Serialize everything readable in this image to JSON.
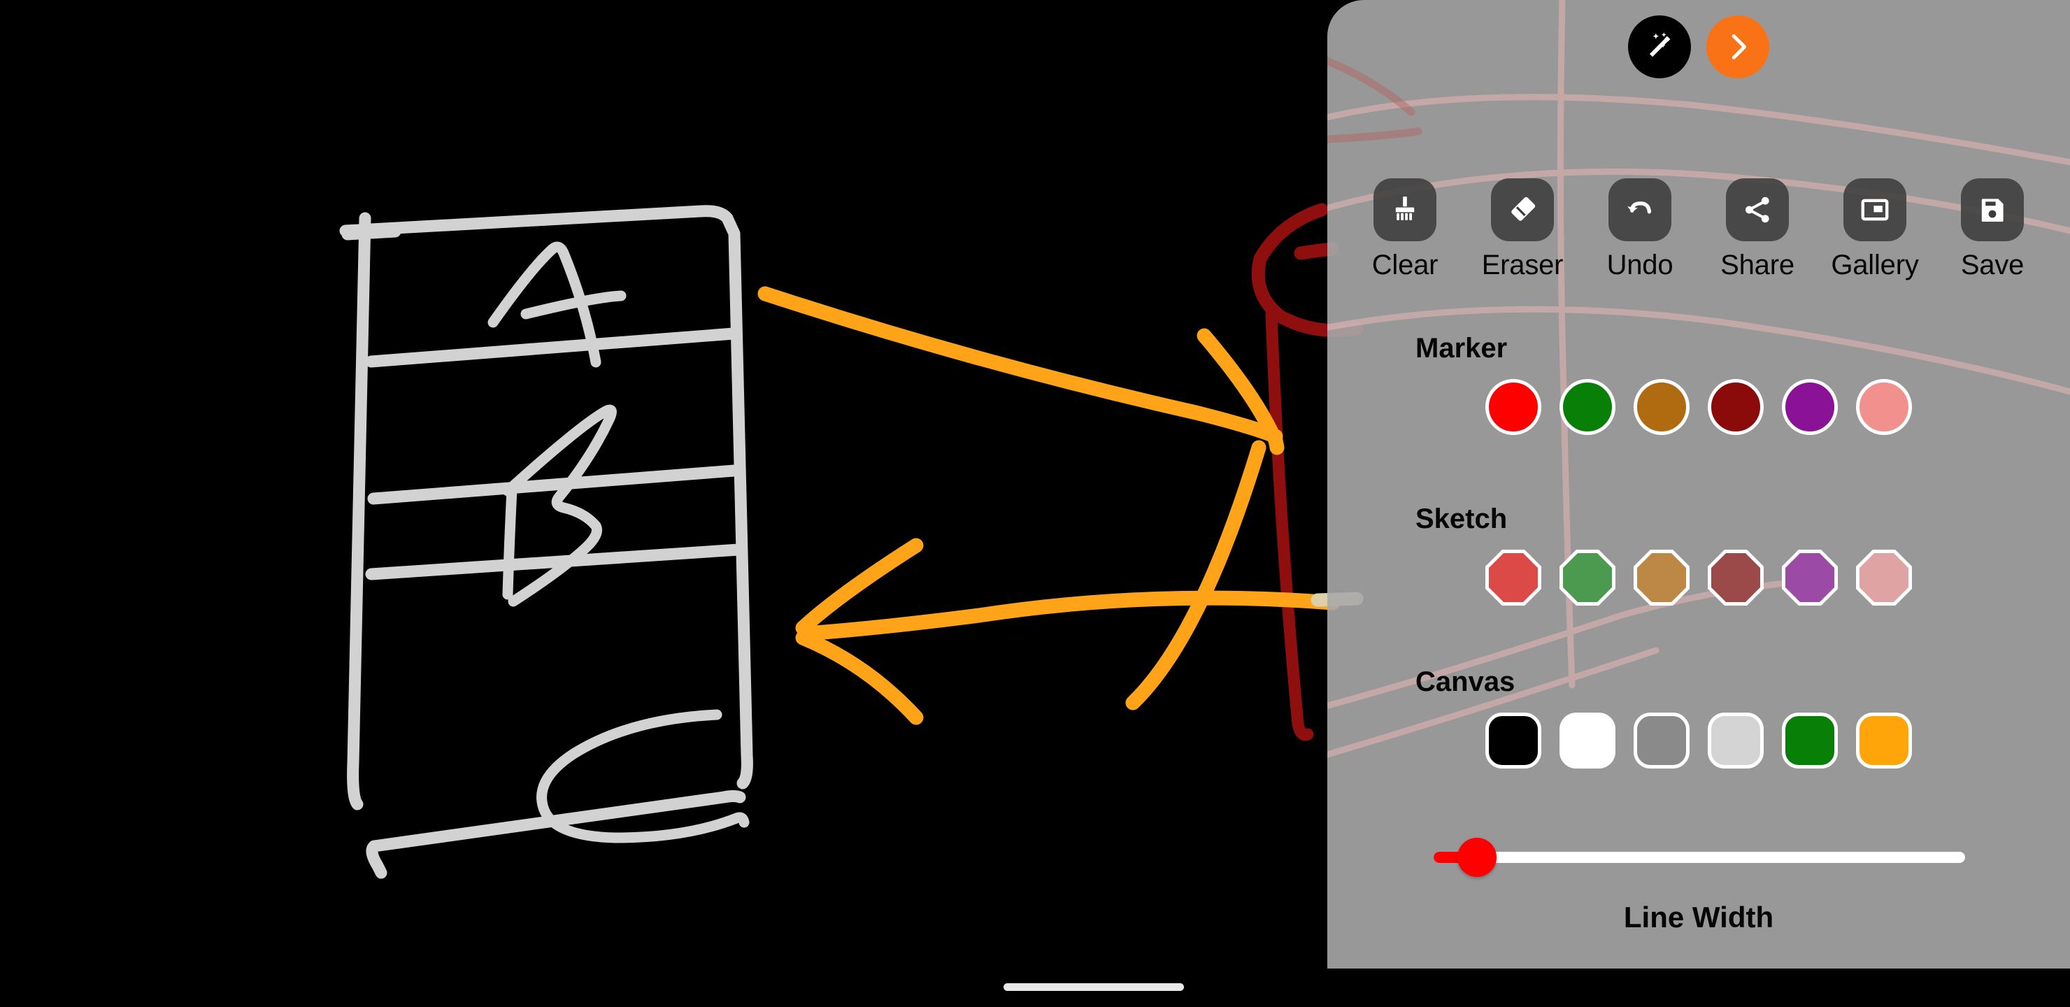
{
  "app": {
    "canvas_background": "#000000",
    "panel_background": "#a8a8a8"
  },
  "drawing": {
    "description": "hand-drawn table with three rows labelled A, B and C, plus two orange arrows and a dark-red loop",
    "stroke_colors": {
      "table": "#d2d2d2",
      "arrow": "#ffa419",
      "loop": "#8f0f0f",
      "faint": "#f0b9b9"
    },
    "letters": [
      "A",
      "B",
      "C"
    ]
  },
  "top_actions": {
    "magic_label": "magic-wand",
    "next_label": "next"
  },
  "toolbar": {
    "items": [
      {
        "label": "Clear",
        "icon": "brush-icon"
      },
      {
        "label": "Eraser",
        "icon": "eraser-icon"
      },
      {
        "label": "Undo",
        "icon": "undo-icon"
      },
      {
        "label": "Share",
        "icon": "share-icon"
      },
      {
        "label": "Gallery",
        "icon": "gallery-icon"
      },
      {
        "label": "Save",
        "icon": "floppy-disk-icon"
      }
    ]
  },
  "sections": [
    {
      "title": "Marker",
      "shape": "circle",
      "colors": [
        "#ff0000",
        "#088008",
        "#b06a10",
        "#8b0b0b",
        "#8a1296",
        "#f2908e"
      ]
    },
    {
      "title": "Sketch",
      "shape": "octagon",
      "colors": [
        "#dc4a48",
        "#4b9a4f",
        "#bd8846",
        "#9c4a49",
        "#9b4aa6",
        "#dfa3a3"
      ]
    },
    {
      "title": "Canvas",
      "shape": "rounded",
      "colors": [
        "#000000",
        "#ffffff",
        "#8a8a8a",
        "#d4d4d4",
        "#088008",
        "#ffa50a"
      ]
    }
  ],
  "slider": {
    "label": "Line Width",
    "value_percent": 4,
    "thumb_color": "#ff0000",
    "track_color": "#ffffff"
  }
}
